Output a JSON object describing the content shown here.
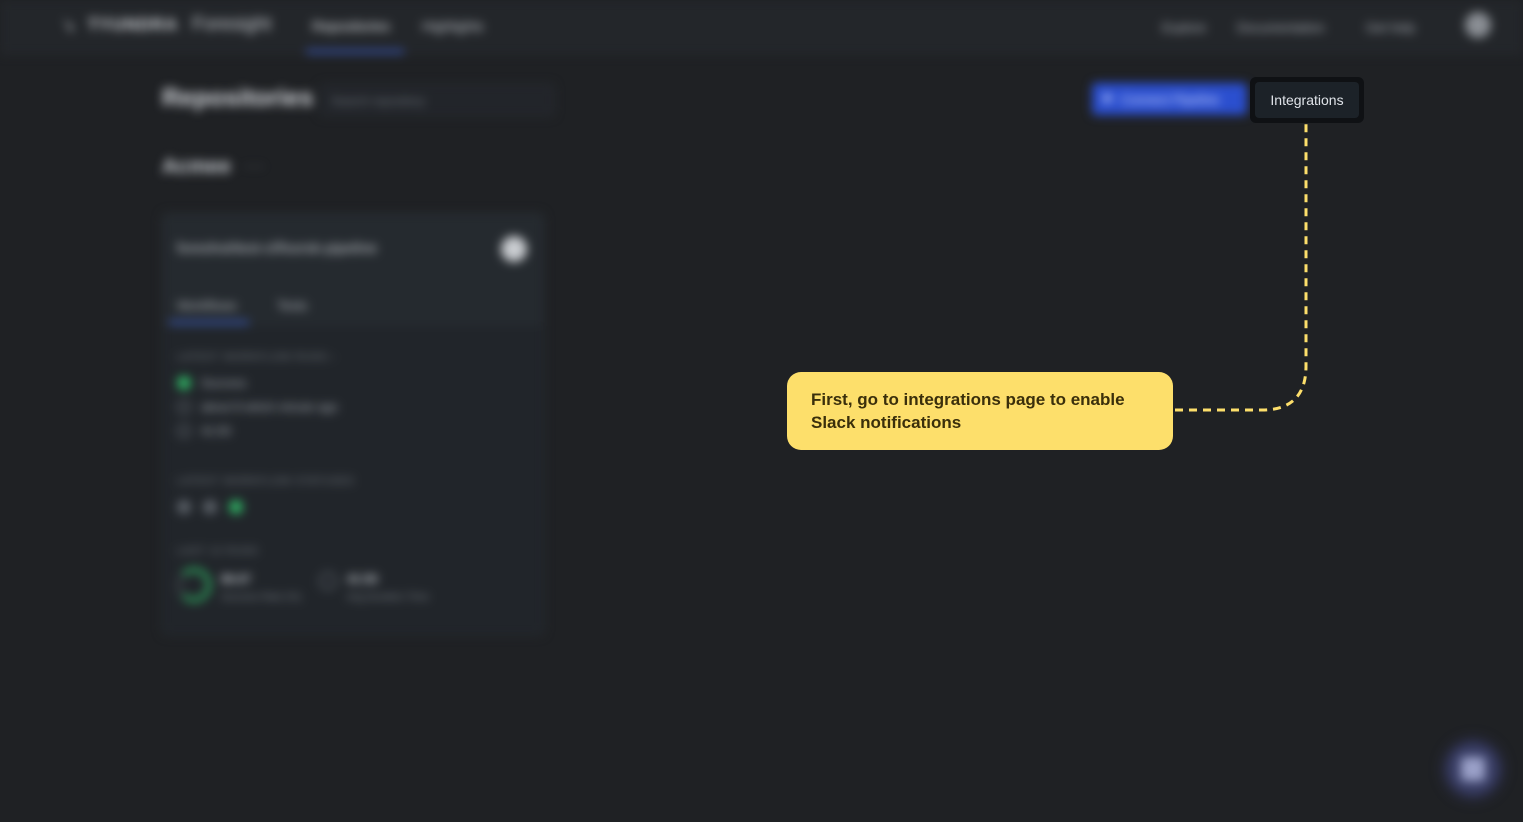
{
  "topbar": {
    "brand": "TYUNDRA",
    "product": "Foresight",
    "tabs": [
      {
        "label": "Repositories"
      },
      {
        "label": "Highlights"
      }
    ],
    "links": [
      {
        "label": "Explore"
      },
      {
        "label": "Documentation"
      },
      {
        "label": "Get help"
      }
    ]
  },
  "header": {
    "title": "Repositories",
    "search_placeholder": "Search repository",
    "connect_button": "Connect Pipeline",
    "integrations_button": "Integrations"
  },
  "org": {
    "name": "Acmee",
    "more": "···"
  },
  "repo_card": {
    "title": "foreshot/test-cl/foorsk-pipeline",
    "tabs": [
      {
        "label": "Workflows"
      },
      {
        "label": "Tests"
      }
    ],
    "latest_run_label": "LATEST WORKFLOW RUNS  ›",
    "latest_run_rows": [
      {
        "text": "Success"
      },
      {
        "text": "about 9 which minute ago"
      },
      {
        "text": "41:50"
      }
    ],
    "latest_statuses_label": "LATEST WORKFLOW STATUSES",
    "last_runs_label": "LAST 10 RUNS",
    "stats": [
      {
        "value": "86.67",
        "sub": "Success Rate (%)"
      },
      {
        "value": "41:50",
        "sub": "Avg Duration Time"
      }
    ]
  },
  "tooltip": {
    "line1": "First, go to integrations page to enable",
    "line2": "Slack notifications"
  },
  "colors": {
    "background": "#1f2124",
    "tooltip": "#fddf6b",
    "accent": "#2b4fcf",
    "success": "#2fb163"
  },
  "icons": [
    "logo-icon",
    "github-icon",
    "chat-icon",
    "connect-icon"
  ]
}
